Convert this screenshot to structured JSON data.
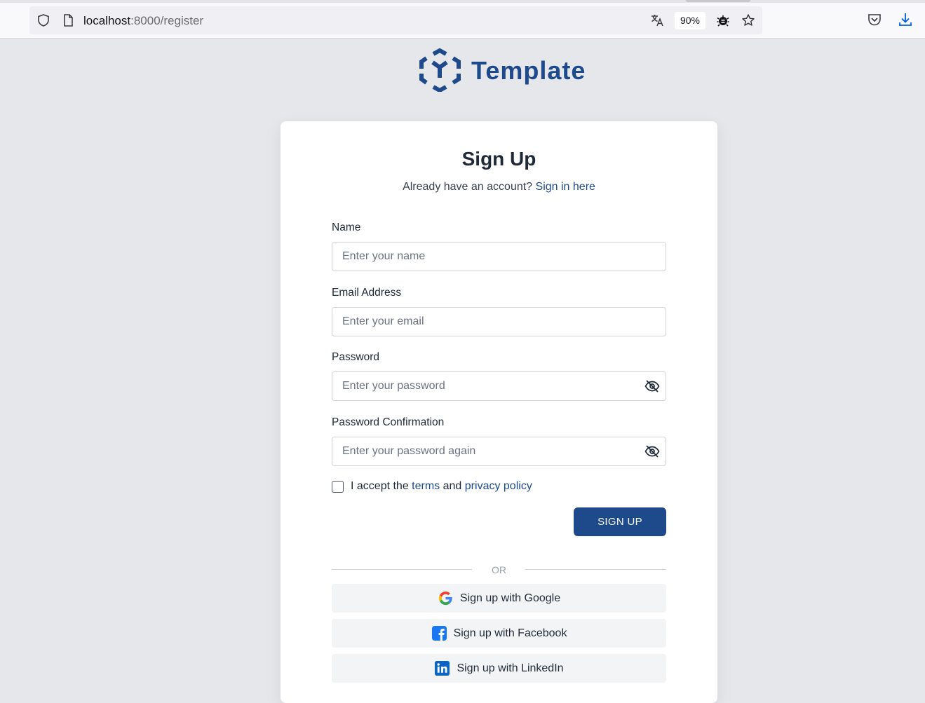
{
  "browser": {
    "url_host": "localhost",
    "url_path": ":8000/register",
    "zoom": "90%"
  },
  "brand": {
    "name": "Template",
    "color": "#1e4a8b"
  },
  "form": {
    "title": "Sign Up",
    "subtitle_prefix": "Already have an account?",
    "signin_link": "Sign in here",
    "fields": {
      "name": {
        "label": "Name",
        "placeholder": "Enter your name"
      },
      "email": {
        "label": "Email Address",
        "placeholder": "Enter your email"
      },
      "password": {
        "label": "Password",
        "placeholder": "Enter your password"
      },
      "password_confirmation": {
        "label": "Password Confirmation",
        "placeholder": "Enter your password again"
      }
    },
    "accept_prefix": "I accept the",
    "terms_link": "terms",
    "and_text": "and",
    "privacy_link": "privacy policy",
    "submit_label": "SIGN UP",
    "divider": "OR",
    "social": {
      "google": "Sign up with Google",
      "facebook": "Sign up with Facebook",
      "linkedin": "Sign up with LinkedIn"
    }
  }
}
